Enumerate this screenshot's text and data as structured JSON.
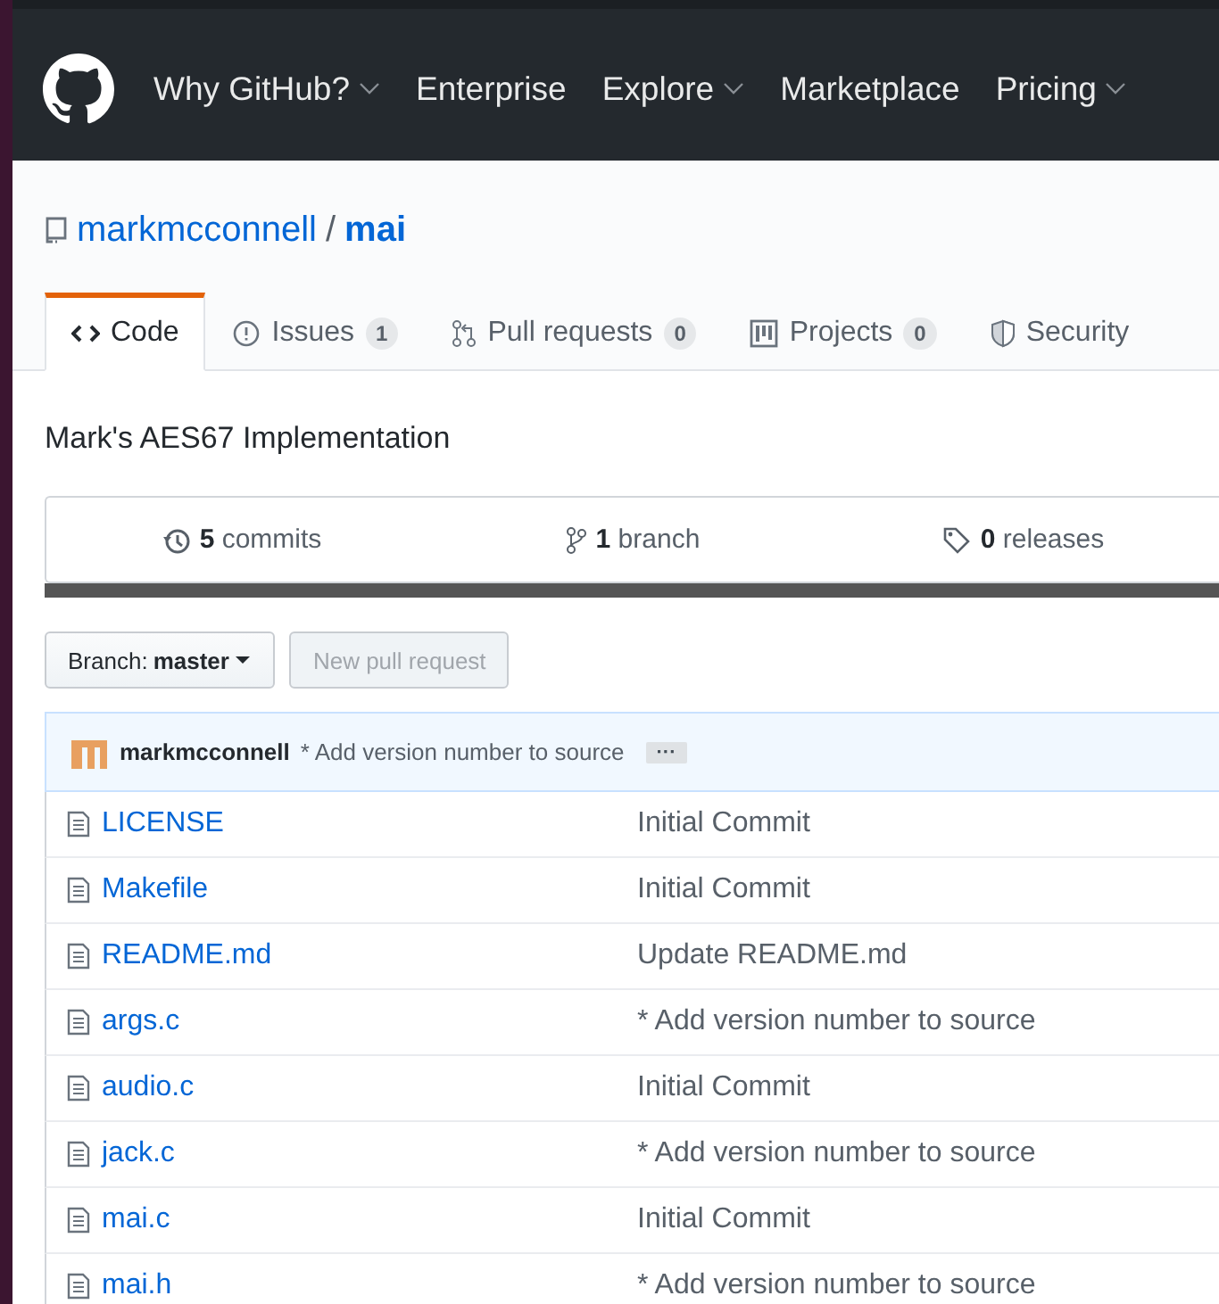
{
  "nav": [
    {
      "label": "Why GitHub?",
      "dropdown": true
    },
    {
      "label": "Enterprise",
      "dropdown": false
    },
    {
      "label": "Explore",
      "dropdown": true
    },
    {
      "label": "Marketplace",
      "dropdown": false
    },
    {
      "label": "Pricing",
      "dropdown": true
    }
  ],
  "repo": {
    "owner": "markmcconnell",
    "separator": "/",
    "name": "mai"
  },
  "tabs": [
    {
      "kind": "code",
      "label": "Code",
      "selected": true
    },
    {
      "kind": "issues",
      "label": "Issues",
      "counter": "1",
      "selected": false
    },
    {
      "kind": "pulls",
      "label": "Pull requests",
      "counter": "0",
      "selected": false
    },
    {
      "kind": "projects",
      "label": "Projects",
      "counter": "0",
      "selected": false
    },
    {
      "kind": "security",
      "label": "Security",
      "selected": false
    }
  ],
  "description": "Mark's AES67 Implementation",
  "stats": [
    {
      "kind": "commits",
      "count": "5",
      "label": "commits"
    },
    {
      "kind": "branch",
      "count": "1",
      "label": "branch"
    },
    {
      "kind": "releases",
      "count": "0",
      "label": "releases"
    }
  ],
  "branch": {
    "label": "Branch:",
    "value": "master"
  },
  "new_pull_request": {
    "label": "New pull request",
    "disabled": true
  },
  "latest_commit": {
    "author": "markmcconnell",
    "message": "* Add version number to source",
    "expander": "···"
  },
  "files": [
    {
      "name": "LICENSE",
      "message": "Initial Commit"
    },
    {
      "name": "Makefile",
      "message": "Initial Commit"
    },
    {
      "name": "README.md",
      "message": "Update README.md"
    },
    {
      "name": "args.c",
      "message": "* Add version number to source"
    },
    {
      "name": "audio.c",
      "message": "Initial Commit"
    },
    {
      "name": "jack.c",
      "message": "* Add version number to source"
    },
    {
      "name": "mai.c",
      "message": "Initial Commit"
    },
    {
      "name": "mai.h",
      "message": "* Add version number to source"
    }
  ]
}
